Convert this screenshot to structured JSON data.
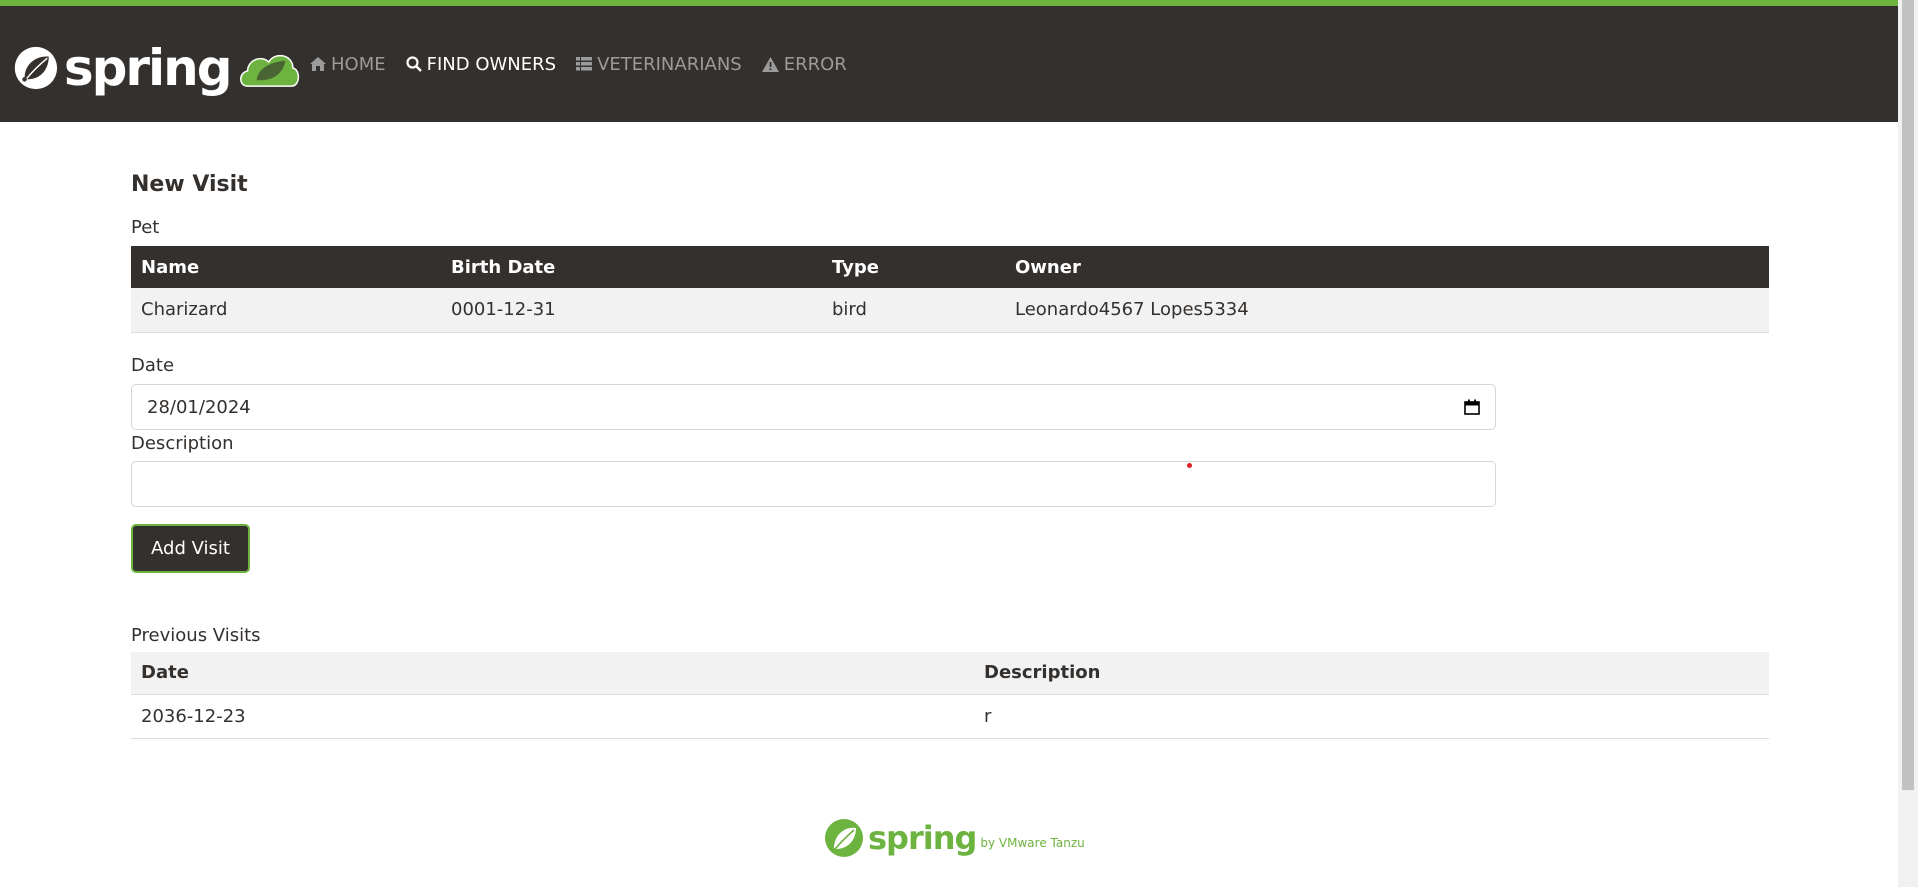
{
  "brand": {
    "name": "spring",
    "accent": "#6db33f",
    "nav_bg": "#34302d"
  },
  "nav": [
    {
      "label": "Home",
      "icon": "home-icon",
      "active": false
    },
    {
      "label": "Find owners",
      "icon": "search-icon",
      "active": true
    },
    {
      "label": "Veterinarians",
      "icon": "list-icon",
      "active": false
    },
    {
      "label": "Error",
      "icon": "warning-icon",
      "active": false
    }
  ],
  "page": {
    "title": "New Visit",
    "pet_label": "Pet",
    "pet_table": {
      "headers": [
        "Name",
        "Birth Date",
        "Type",
        "Owner"
      ],
      "row": [
        "Charizard",
        "0001-12-31",
        "bird",
        "Leonardo4567 Lopes5334"
      ]
    },
    "form": {
      "date_label": "Date",
      "date_value": "28/01/2024",
      "description_label": "Description",
      "description_value": "",
      "submit_label": "Add Visit"
    },
    "previous_visits": {
      "label": "Previous Visits",
      "headers": [
        "Date",
        "Description"
      ],
      "rows": [
        [
          "2036-12-23",
          "r"
        ]
      ]
    }
  },
  "footer": {
    "brand": "spring",
    "by": "by VMware Tanzu"
  }
}
